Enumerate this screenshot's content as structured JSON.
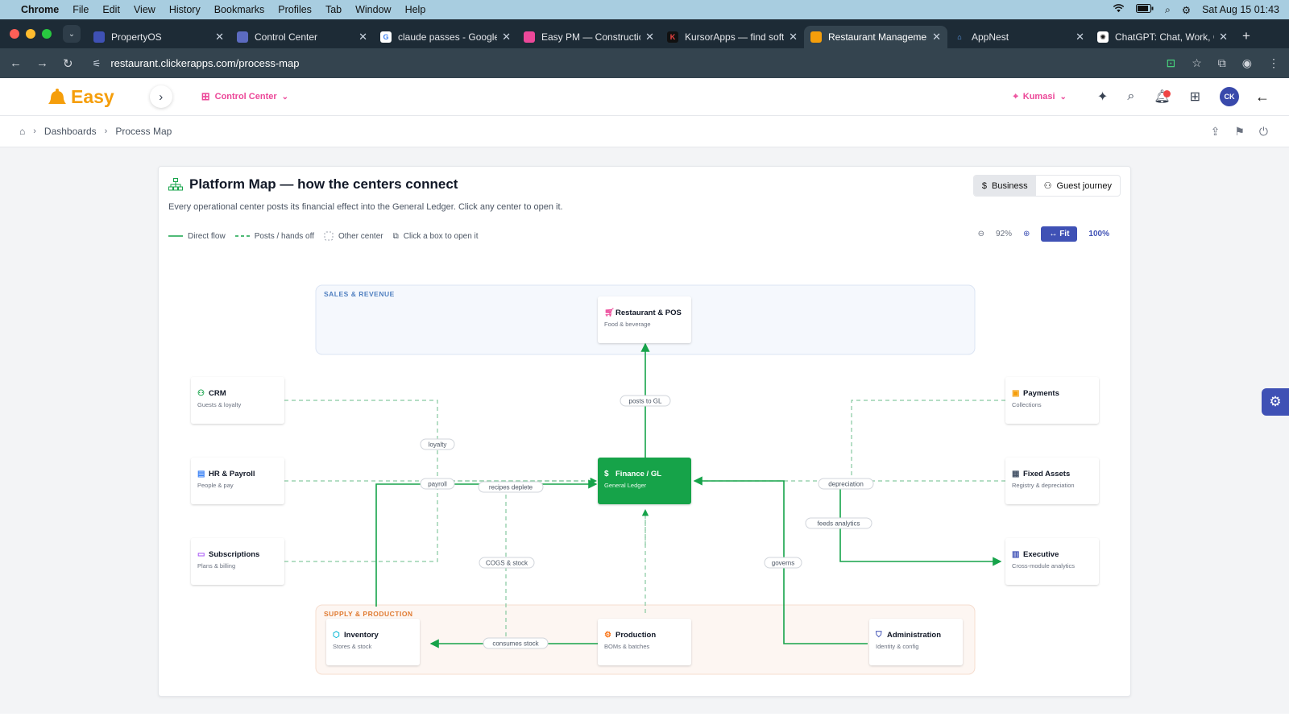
{
  "mac": {
    "menu": [
      "Chrome",
      "File",
      "Edit",
      "View",
      "History",
      "Bookmarks",
      "Profiles",
      "Tab",
      "Window",
      "Help"
    ],
    "datetime": "Sat Aug 15  01:43"
  },
  "tabs": [
    {
      "title": "PropertyOS",
      "color": "#3f51b5"
    },
    {
      "title": "Control Center",
      "color": "#5c6bc0"
    },
    {
      "title": "claude passes - Google S",
      "color": "#ffffff"
    },
    {
      "title": "Easy PM — Construction",
      "color": "#ec4899"
    },
    {
      "title": "KursorApps — find softw",
      "color": "#111111"
    },
    {
      "title": "Restaurant Management",
      "color": "#f59e0b"
    },
    {
      "title": "AppNest",
      "color": "#3b82f6"
    },
    {
      "title": "ChatGPT: Chat, Work, Cr",
      "color": "#ffffff"
    }
  ],
  "url": "restaurant.clickerapps.com/process-map",
  "app": {
    "brand": "Easy",
    "center": "Control Center",
    "location": "Kumasi",
    "avatar": "CK"
  },
  "breadcrumb": {
    "a": "Dashboards",
    "b": "Process Map"
  },
  "page": {
    "title": "Platform Map — how the centers connect",
    "subtitle": "Every operational center posts its financial effect into the General Ledger. Click any center to open it.",
    "toggle": {
      "business": "Business",
      "guest": "Guest journey"
    },
    "legend": {
      "direct": "Direct flow",
      "posts": "Posts / hands off",
      "other": "Other center",
      "click": "Click a box to open it"
    },
    "zoom": {
      "pct": "92%",
      "fit": "Fit",
      "full": "100%"
    }
  },
  "map": {
    "groups": {
      "sales": "SALES & REVENUE",
      "supply": "SUPPLY & PRODUCTION"
    },
    "nodes": {
      "pos": {
        "title": "Restaurant & POS",
        "sub": "Food & beverage",
        "icon": "cart-icon"
      },
      "crm": {
        "title": "CRM",
        "sub": "Guests & loyalty",
        "icon": "users-icon"
      },
      "hr": {
        "title": "HR & Payroll",
        "sub": "People & pay",
        "icon": "id-card-icon"
      },
      "subs": {
        "title": "Subscriptions",
        "sub": "Plans & billing",
        "icon": "card-icon"
      },
      "gl": {
        "title": "Finance / GL",
        "sub": "General Ledger",
        "icon": "dollar-icon"
      },
      "pay": {
        "title": "Payments",
        "sub": "Collections",
        "icon": "wallet-icon"
      },
      "fa": {
        "title": "Fixed Assets",
        "sub": "Registry & depreciation",
        "icon": "building-icon"
      },
      "exec": {
        "title": "Executive",
        "sub": "Cross-module analytics",
        "icon": "bar-chart-icon"
      },
      "inv": {
        "title": "Inventory",
        "sub": "Stores & stock",
        "icon": "box-icon"
      },
      "prod": {
        "title": "Production",
        "sub": "BOMs & batches",
        "icon": "gear-icon"
      },
      "admin": {
        "title": "Administration",
        "sub": "Identity & config",
        "icon": "shield-icon"
      }
    },
    "edges": {
      "posts_to_gl": "posts to GL",
      "loyalty": "loyalty",
      "payroll": "payroll",
      "recipes": "recipes deplete",
      "cogs": "COGS & stock",
      "consumes": "consumes stock",
      "depreciation": "depreciation",
      "feeds": "feeds analytics",
      "governs": "governs"
    },
    "colors": {
      "green": "#16a34a",
      "dash": "#86c9a0",
      "gl": "#16a34a",
      "sales_bg": "#f5f8fd",
      "supply_bg": "#fdf6f2"
    }
  }
}
